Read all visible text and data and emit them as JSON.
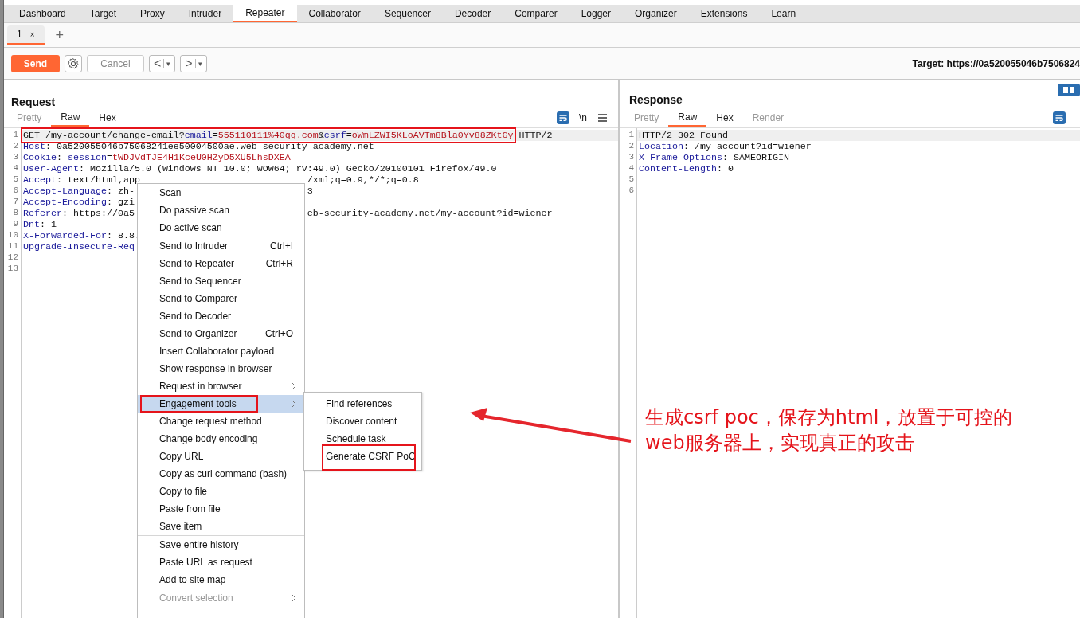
{
  "main_tabs": [
    {
      "label": "Dashboard",
      "selected": false
    },
    {
      "label": "Target",
      "selected": false
    },
    {
      "label": "Proxy",
      "selected": false
    },
    {
      "label": "Intruder",
      "selected": false
    },
    {
      "label": "Repeater",
      "selected": true
    },
    {
      "label": "Collaborator",
      "selected": false
    },
    {
      "label": "Sequencer",
      "selected": false
    },
    {
      "label": "Decoder",
      "selected": false
    },
    {
      "label": "Comparer",
      "selected": false
    },
    {
      "label": "Logger",
      "selected": false
    },
    {
      "label": "Organizer",
      "selected": false
    },
    {
      "label": "Extensions",
      "selected": false
    },
    {
      "label": "Learn",
      "selected": false
    }
  ],
  "sub_tabs": [
    {
      "label": "1",
      "close": "×",
      "selected": true
    }
  ],
  "add_tab": "+",
  "toolbar": {
    "send": "Send",
    "cancel": "Cancel",
    "cancel_disabled": true,
    "back": "<",
    "forward": ">",
    "dropdown": "▾",
    "target": "Target: https://0a520055046b7506824"
  },
  "request": {
    "title": "Request",
    "tabs": [
      {
        "label": "Pretty",
        "selected": false,
        "disabled": true
      },
      {
        "label": "Raw",
        "selected": true,
        "disabled": false
      },
      {
        "label": "Hex",
        "selected": false,
        "disabled": false
      }
    ],
    "newline_toggle": "\\n",
    "lines": [
      {
        "number": "1",
        "highlighted": true,
        "annotated": true,
        "tokens": [
          {
            "kind": "plain",
            "text": "GET /my-account/change-email?"
          },
          {
            "kind": "name",
            "text": "email"
          },
          {
            "kind": "plain",
            "text": "="
          },
          {
            "kind": "value",
            "text": "555110111%40qq.com"
          },
          {
            "kind": "plain",
            "text": "&"
          },
          {
            "kind": "name",
            "text": "csrf"
          },
          {
            "kind": "plain",
            "text": "="
          },
          {
            "kind": "value",
            "text": "oWmLZWI5KLoAVTm8Bla0Yv88ZKtGy"
          }
        ],
        "after": " HTTP/2"
      },
      {
        "number": "2",
        "highlighted": false,
        "annotated": false,
        "tokens": [
          {
            "kind": "name",
            "text": "Host"
          },
          {
            "kind": "plain",
            "text": ": 0a520055046b75068241ee50004500ae.web-security-academy.net"
          }
        ]
      },
      {
        "number": "3",
        "highlighted": false,
        "annotated": false,
        "tokens": [
          {
            "kind": "name",
            "text": "Cookie"
          },
          {
            "kind": "plain",
            "text": ": "
          },
          {
            "kind": "name",
            "text": "session"
          },
          {
            "kind": "plain",
            "text": "="
          },
          {
            "kind": "value",
            "text": "tWDJVdTJE4H1KceU0HZyD5XU5LhsDXEA"
          }
        ]
      },
      {
        "number": "4",
        "highlighted": false,
        "annotated": false,
        "tokens": [
          {
            "kind": "name",
            "text": "User-Agent"
          },
          {
            "kind": "plain",
            "text": ": Mozilla/5.0 (Windows NT 10.0; WOW64; rv:49.0) Gecko/20100101 Firefox/49.0"
          }
        ]
      },
      {
        "number": "5",
        "highlighted": false,
        "annotated": false,
        "tokens": [
          {
            "kind": "name",
            "text": "Accept"
          },
          {
            "kind": "plain",
            "text": ": text/html,app"
          }
        ],
        "tail": "/xml;q=0.9,*/*;q=0.8"
      },
      {
        "number": "6",
        "highlighted": false,
        "annotated": false,
        "tokens": [
          {
            "kind": "name",
            "text": "Accept-Language"
          },
          {
            "kind": "plain",
            "text": ": zh-"
          }
        ],
        "tail": "3"
      },
      {
        "number": "7",
        "highlighted": false,
        "annotated": false,
        "tokens": [
          {
            "kind": "name",
            "text": "Accept-Encoding"
          },
          {
            "kind": "plain",
            "text": ": gzi"
          }
        ]
      },
      {
        "number": "8",
        "highlighted": false,
        "annotated": false,
        "tokens": [
          {
            "kind": "name",
            "text": "Referer"
          },
          {
            "kind": "plain",
            "text": ": https://0a5"
          }
        ],
        "tail": "eb-security-academy.net/my-account?id=wiener"
      },
      {
        "number": "9",
        "highlighted": false,
        "annotated": false,
        "tokens": [
          {
            "kind": "name",
            "text": "Dnt"
          },
          {
            "kind": "plain",
            "text": ": 1"
          }
        ]
      },
      {
        "number": "10",
        "highlighted": false,
        "annotated": false,
        "tokens": [
          {
            "kind": "name",
            "text": "X-Forwarded-For"
          },
          {
            "kind": "plain",
            "text": ": 8.8."
          }
        ]
      },
      {
        "number": "11",
        "highlighted": false,
        "annotated": false,
        "tokens": [
          {
            "kind": "name",
            "text": "Upgrade-Insecure-Req"
          }
        ]
      },
      {
        "number": "12",
        "highlighted": false,
        "annotated": false
      },
      {
        "number": "13",
        "highlighted": false,
        "annotated": false
      }
    ]
  },
  "response": {
    "title": "Response",
    "tabs": [
      {
        "label": "Pretty",
        "selected": false,
        "disabled": true
      },
      {
        "label": "Raw",
        "selected": true,
        "disabled": false
      },
      {
        "label": "Hex",
        "selected": false,
        "disabled": false
      },
      {
        "label": "Render",
        "selected": false,
        "disabled": true
      }
    ],
    "lines": [
      {
        "number": "1",
        "highlighted": true,
        "tokens": [
          {
            "kind": "plain",
            "text": "HTTP/2 302 Found"
          }
        ]
      },
      {
        "number": "2",
        "highlighted": false,
        "tokens": [
          {
            "kind": "name",
            "text": "Location"
          },
          {
            "kind": "plain",
            "text": ": /my-account?id=wiener"
          }
        ]
      },
      {
        "number": "3",
        "highlighted": false,
        "tokens": [
          {
            "kind": "name",
            "text": "X-Frame-Options"
          },
          {
            "kind": "plain",
            "text": ": SAMEORIGIN"
          }
        ]
      },
      {
        "number": "4",
        "highlighted": false,
        "tokens": [
          {
            "kind": "name",
            "text": "Content-Length"
          },
          {
            "kind": "plain",
            "text": ": 0"
          }
        ]
      },
      {
        "number": "5",
        "highlighted": false
      },
      {
        "number": "6",
        "highlighted": false
      }
    ]
  },
  "context_menu": {
    "groups": [
      [
        {
          "label": "Scan",
          "disabled": false,
          "selected": false,
          "annotated": false,
          "submenu": false
        },
        {
          "label": "Do passive scan",
          "disabled": false,
          "selected": false,
          "annotated": false,
          "submenu": false
        },
        {
          "label": "Do active scan",
          "disabled": false,
          "selected": false,
          "annotated": false,
          "submenu": false
        }
      ],
      [
        {
          "label": "Send to Intruder",
          "shortcut": "Ctrl+I",
          "disabled": false,
          "selected": false,
          "annotated": false,
          "submenu": false
        },
        {
          "label": "Send to Repeater",
          "shortcut": "Ctrl+R",
          "disabled": false,
          "selected": false,
          "annotated": false,
          "submenu": false
        },
        {
          "label": "Send to Sequencer",
          "disabled": false,
          "selected": false,
          "annotated": false,
          "submenu": false
        },
        {
          "label": "Send to Comparer",
          "disabled": false,
          "selected": false,
          "annotated": false,
          "submenu": false
        },
        {
          "label": "Send to Decoder",
          "disabled": false,
          "selected": false,
          "annotated": false,
          "submenu": false
        },
        {
          "label": "Send to Organizer",
          "shortcut": "Ctrl+O",
          "disabled": false,
          "selected": false,
          "annotated": false,
          "submenu": false
        },
        {
          "label": "Insert Collaborator payload",
          "disabled": false,
          "selected": false,
          "annotated": false,
          "submenu": false
        },
        {
          "label": "Show response in browser",
          "disabled": false,
          "selected": false,
          "annotated": false,
          "submenu": false
        },
        {
          "label": "Request in browser",
          "disabled": false,
          "selected": false,
          "annotated": false,
          "submenu": true
        },
        {
          "label": "Engagement tools",
          "disabled": false,
          "selected": true,
          "annotated": true,
          "submenu": true
        },
        {
          "label": "Change request method",
          "disabled": false,
          "selected": false,
          "annotated": false,
          "submenu": false
        },
        {
          "label": "Change body encoding",
          "disabled": false,
          "selected": false,
          "annotated": false,
          "submenu": false
        },
        {
          "label": "Copy URL",
          "disabled": false,
          "selected": false,
          "annotated": false,
          "submenu": false
        },
        {
          "label": "Copy as curl command (bash)",
          "disabled": false,
          "selected": false,
          "annotated": false,
          "submenu": false
        },
        {
          "label": "Copy to file",
          "disabled": false,
          "selected": false,
          "annotated": false,
          "submenu": false
        },
        {
          "label": "Paste from file",
          "disabled": false,
          "selected": false,
          "annotated": false,
          "submenu": false
        },
        {
          "label": "Save item",
          "disabled": false,
          "selected": false,
          "annotated": false,
          "submenu": false
        }
      ],
      [
        {
          "label": "Save entire history",
          "disabled": false,
          "selected": false,
          "annotated": false,
          "submenu": false
        },
        {
          "label": "Paste URL as request",
          "disabled": false,
          "selected": false,
          "annotated": false,
          "submenu": false
        },
        {
          "label": "Add to site map",
          "disabled": false,
          "selected": false,
          "annotated": false,
          "submenu": false
        }
      ],
      [
        {
          "label": "Convert selection",
          "disabled": true,
          "selected": false,
          "annotated": false,
          "submenu": true
        }
      ]
    ]
  },
  "submenu": [
    {
      "label": "Find references",
      "annotated": false
    },
    {
      "label": "Discover content",
      "annotated": false
    },
    {
      "label": "Schedule task",
      "annotated": false
    },
    {
      "label": "Generate CSRF PoC",
      "annotated": true
    }
  ],
  "annotation": {
    "lines": [
      "生成csrf poc，保存为html，放置于可控的",
      "web服务器上，实现真正的攻击"
    ]
  }
}
